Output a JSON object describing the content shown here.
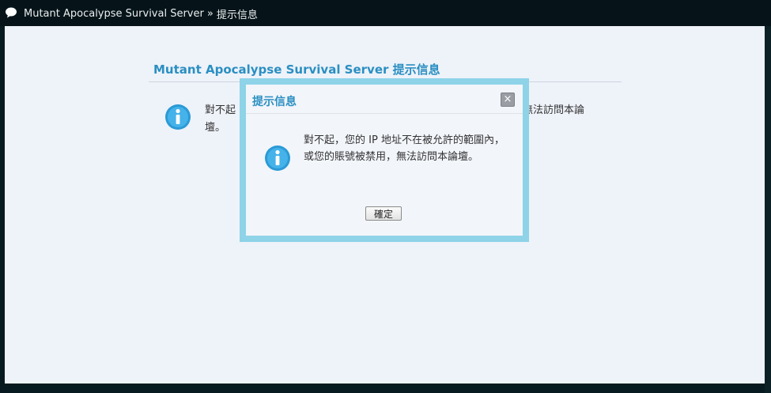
{
  "topbar": {
    "site_name": "Mutant Apocalypse Survival Server",
    "separator": "»",
    "current": "提示信息"
  },
  "page": {
    "title": "Mutant Apocalypse Survival Server 提示信息",
    "message_left": "對不起 壇。",
    "message_right": "無法訪問本論"
  },
  "dialog": {
    "title": "提示信息",
    "close_label": "×",
    "message": "對不起，您的 IP 地址不在被允許的範圍內，或您的賬號被禁用，無法訪問本論壇。",
    "ok_label": "確定"
  },
  "colors": {
    "accent": "#2a8fc2",
    "dialog_border": "#8ed3e8",
    "page_bg": "#eef2f9",
    "top_bar": "#061419"
  },
  "icons": [
    "chat-bubble-icon",
    "info-icon",
    "close-icon"
  ]
}
